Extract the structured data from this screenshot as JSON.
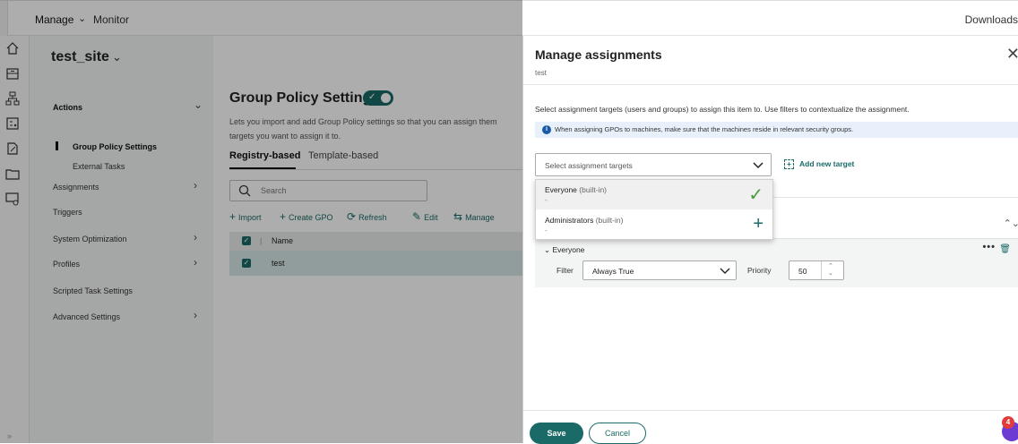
{
  "topbar": {
    "manage": "Manage",
    "monitor": "Monitor",
    "downloads": "Downloads"
  },
  "site": {
    "title": "test_site",
    "nav": [
      {
        "label": "Actions"
      },
      {
        "label": "Group Policy Settings"
      },
      {
        "label": "External Tasks"
      },
      {
        "label": "Assignments"
      },
      {
        "label": "Triggers"
      },
      {
        "label": "System Optimization"
      },
      {
        "label": "Profiles"
      },
      {
        "label": "Scripted Task Settings"
      },
      {
        "label": "Advanced Settings"
      }
    ]
  },
  "main": {
    "title": "Group Policy Settings",
    "desc_line1": "Lets you import and add Group Policy settings so that you can assign them",
    "desc_line2": "targets you want to assign it to.",
    "tabs": [
      "Registry-based",
      "Template-based"
    ],
    "search_placeholder": "Search",
    "toolbar": [
      "Import",
      "Create GPO",
      "Refresh",
      "Edit",
      "Manage"
    ],
    "table": {
      "header": "Name",
      "rows": [
        "test"
      ]
    }
  },
  "drawer": {
    "title": "Manage assignments",
    "subtitle": "test",
    "instruction": "Select assignment targets (users and groups) to assign this item to. Use filters to contextualize the assignment.",
    "info": "When assigning GPOs to machines, make sure that the machines reside in relevant security groups.",
    "select_placeholder": "Select assignment targets",
    "add_new": "Add new target",
    "options": [
      {
        "name": "Everyone",
        "suffix": "(built-in)",
        "detail": "-"
      },
      {
        "name": "Administrators",
        "suffix": "(built-in)",
        "detail": "-"
      }
    ],
    "assignment": {
      "name": "Everyone",
      "filter_label": "Filter",
      "filter_value": "Always True",
      "priority_label": "Priority",
      "priority_value": "50"
    },
    "save": "Save",
    "cancel": "Cancel"
  },
  "notification_count": "4",
  "colors": {
    "accent": "#1a6b67",
    "info": "#1b5aa6",
    "badge": "#e23b3b"
  }
}
